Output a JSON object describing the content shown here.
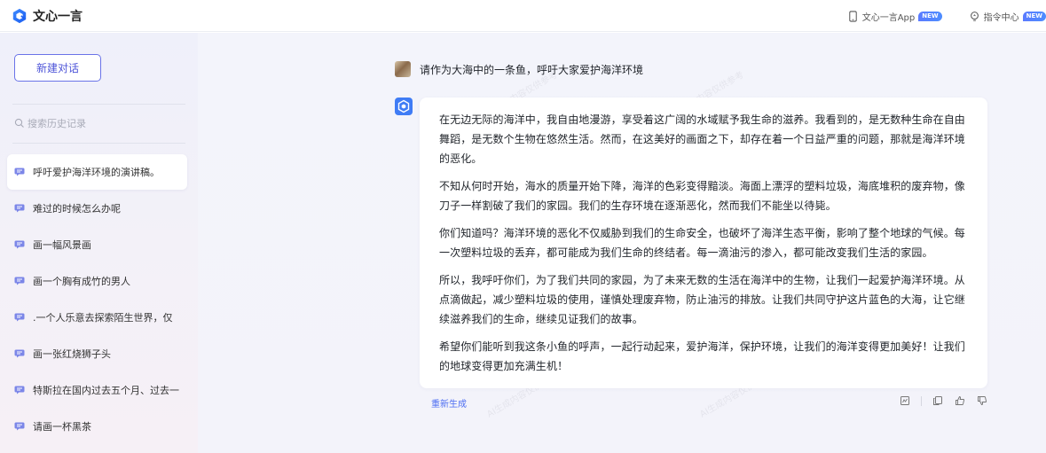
{
  "app": {
    "name": "文心一言"
  },
  "topbar": {
    "app_link": "文心一言App",
    "app_badge": "NEW",
    "command_link": "指令中心",
    "command_badge": "NEW"
  },
  "sidebar": {
    "new_chat": "新建对话",
    "search_placeholder": "搜索历史记录",
    "history": [
      {
        "label": "呼吁爱护海洋环境的演讲稿。",
        "active": true
      },
      {
        "label": "难过的时候怎么办呢"
      },
      {
        "label": "画一幅风景画"
      },
      {
        "label": "画一个胸有成竹的男人"
      },
      {
        "label": ".一个人乐意去探索陌生世界，仅"
      },
      {
        "label": "画一张红烧狮子头"
      },
      {
        "label": "特斯拉在国内过去五个月、过去一"
      },
      {
        "label": "请画一杯黑茶"
      }
    ]
  },
  "conversation": {
    "user_message": "请作为大海中的一条鱼，呼吁大家爱护海洋环境",
    "answer_paragraphs": [
      "在无边无际的海洋中，我自由地漫游，享受着这广阔的水域赋予我生命的滋养。我看到的，是无数种生命在自由舞蹈，是无数个生物在悠然生活。然而，在这美好的画面之下，却存在着一个日益严重的问题，那就是海洋环境的恶化。",
      "不知从何时开始，海水的质量开始下降，海洋的色彩变得黯淡。海面上漂浮的塑料垃圾，海底堆积的废弃物，像刀子一样割破了我们的家园。我们的生存环境在逐渐恶化，然而我们不能坐以待毙。",
      "你们知道吗？海洋环境的恶化不仅威胁到我们的生命安全，也破坏了海洋生态平衡，影响了整个地球的气候。每一次塑料垃圾的丢弃，都可能成为我们生命的终结者。每一滴油污的渗入，都可能改变我们生活的家园。",
      "所以，我呼吁你们，为了我们共同的家园，为了未来无数的生活在海洋中的生物，让我们一起爱护海洋环境。从点滴做起，减少塑料垃圾的使用，谨慎处理废弃物，防止油污的排放。让我们共同守护这片蓝色的大海，让它继续滋养我们的生命，继续见证我们的故事。",
      "希望你们能听到我这条小鱼的呼声，一起行动起来，爱护海洋，保护环境，让我们的海洋变得更加美好！让我们的地球变得更加充满生机！"
    ],
    "regenerate": "重新生成"
  },
  "colors": {
    "accent": "#4e55d8",
    "link": "#4e6ef2",
    "badge": "#5b7bff"
  },
  "icons": [
    "logo-icon",
    "phone-icon",
    "bulb-icon",
    "search-icon",
    "chat-icon",
    "bot-avatar-icon",
    "bookmark-icon",
    "copy-icon",
    "thumbs-up-icon",
    "thumbs-down-icon"
  ]
}
